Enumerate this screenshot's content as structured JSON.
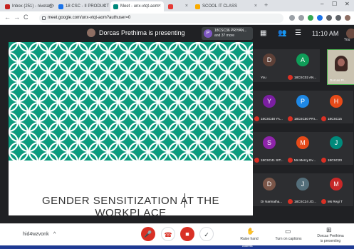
{
  "browser": {
    "tabs": [
      {
        "label": "Inbox (251) - niveta@vvce.edu.in",
        "fav": "#c5221f"
      },
      {
        "label": "18 CSC - II PRODUCT DESIGN",
        "fav": "#1a73e8"
      },
      {
        "label": "Meet - unx-vtqt-aom",
        "fav": "#00897b"
      },
      {
        "label": "",
        "fav": "#e53935"
      },
      {
        "label": "SCOOL IT CLASS",
        "fav": "#f9ab00"
      }
    ],
    "new_tab": "+",
    "window_controls": [
      "–",
      "☐",
      "✕"
    ],
    "url": "meet.google.com/unx-vtqt-aom?authuser=0",
    "nav": [
      "←",
      "→",
      "C"
    ]
  },
  "meet": {
    "presenting_banner": "Dorcas Prethima is presenting",
    "participants_chip": {
      "initial": "P",
      "line1": "18CSC36 PRIYAN...",
      "line2": "and 37 more"
    },
    "time": "11:10 AM",
    "you_label": "You",
    "slide_title": "GENDER SENSITIZATION AT THE WORKPLACE",
    "tiles": [
      {
        "initial": "D",
        "name": "You",
        "color": "#5d4037",
        "row": 0,
        "col": 0,
        "muted": false
      },
      {
        "initial": "A",
        "name": "18CSC02 AN...",
        "color": "#0f9d58",
        "row": 0,
        "col": 1,
        "muted": true
      },
      {
        "initial": "Y",
        "name": "18CSC48 YA...",
        "color": "#7b1fa2",
        "row": 1,
        "col": 0,
        "muted": true
      },
      {
        "initial": "P",
        "name": "18CSC50 PRI...",
        "color": "#1e88e5",
        "row": 1,
        "col": 1,
        "muted": true
      },
      {
        "initial": "H",
        "name": "18CSC15",
        "color": "#e64a19",
        "row": 1,
        "col": 2,
        "muted": true
      },
      {
        "initial": "S",
        "name": "18CSC41 SIT...",
        "color": "#8e24aa",
        "row": 2,
        "col": 0,
        "muted": true
      },
      {
        "initial": "M",
        "name": "Ms Mercy Ev...",
        "color": "#e64a19",
        "row": 2,
        "col": 1,
        "muted": true
      },
      {
        "initial": "J",
        "name": "18CSC20",
        "color": "#00897b",
        "row": 2,
        "col": 2,
        "muted": true
      },
      {
        "initial": "D",
        "name": "Dr Narmatha...",
        "color": "#795548",
        "row": 3,
        "col": 0,
        "muted": false
      },
      {
        "initial": "J",
        "name": "18CSC24 JO...",
        "color": "#546e7a",
        "row": 3,
        "col": 1,
        "muted": true
      },
      {
        "initial": "M",
        "name": "Ms Regi T",
        "color": "#c62828",
        "row": 3,
        "col": 2,
        "muted": true
      }
    ],
    "self_view_label": "Dorcas Pr..."
  },
  "controls": {
    "meeting_code": "hid4wzvonk",
    "chevron": "^",
    "raise_hand": "Raise hand",
    "captions": "Turn on captions",
    "presenting_line1": "Dorcas Prethima",
    "presenting_line2": "is presenting"
  },
  "taskbar": {
    "address_label": "Address"
  }
}
